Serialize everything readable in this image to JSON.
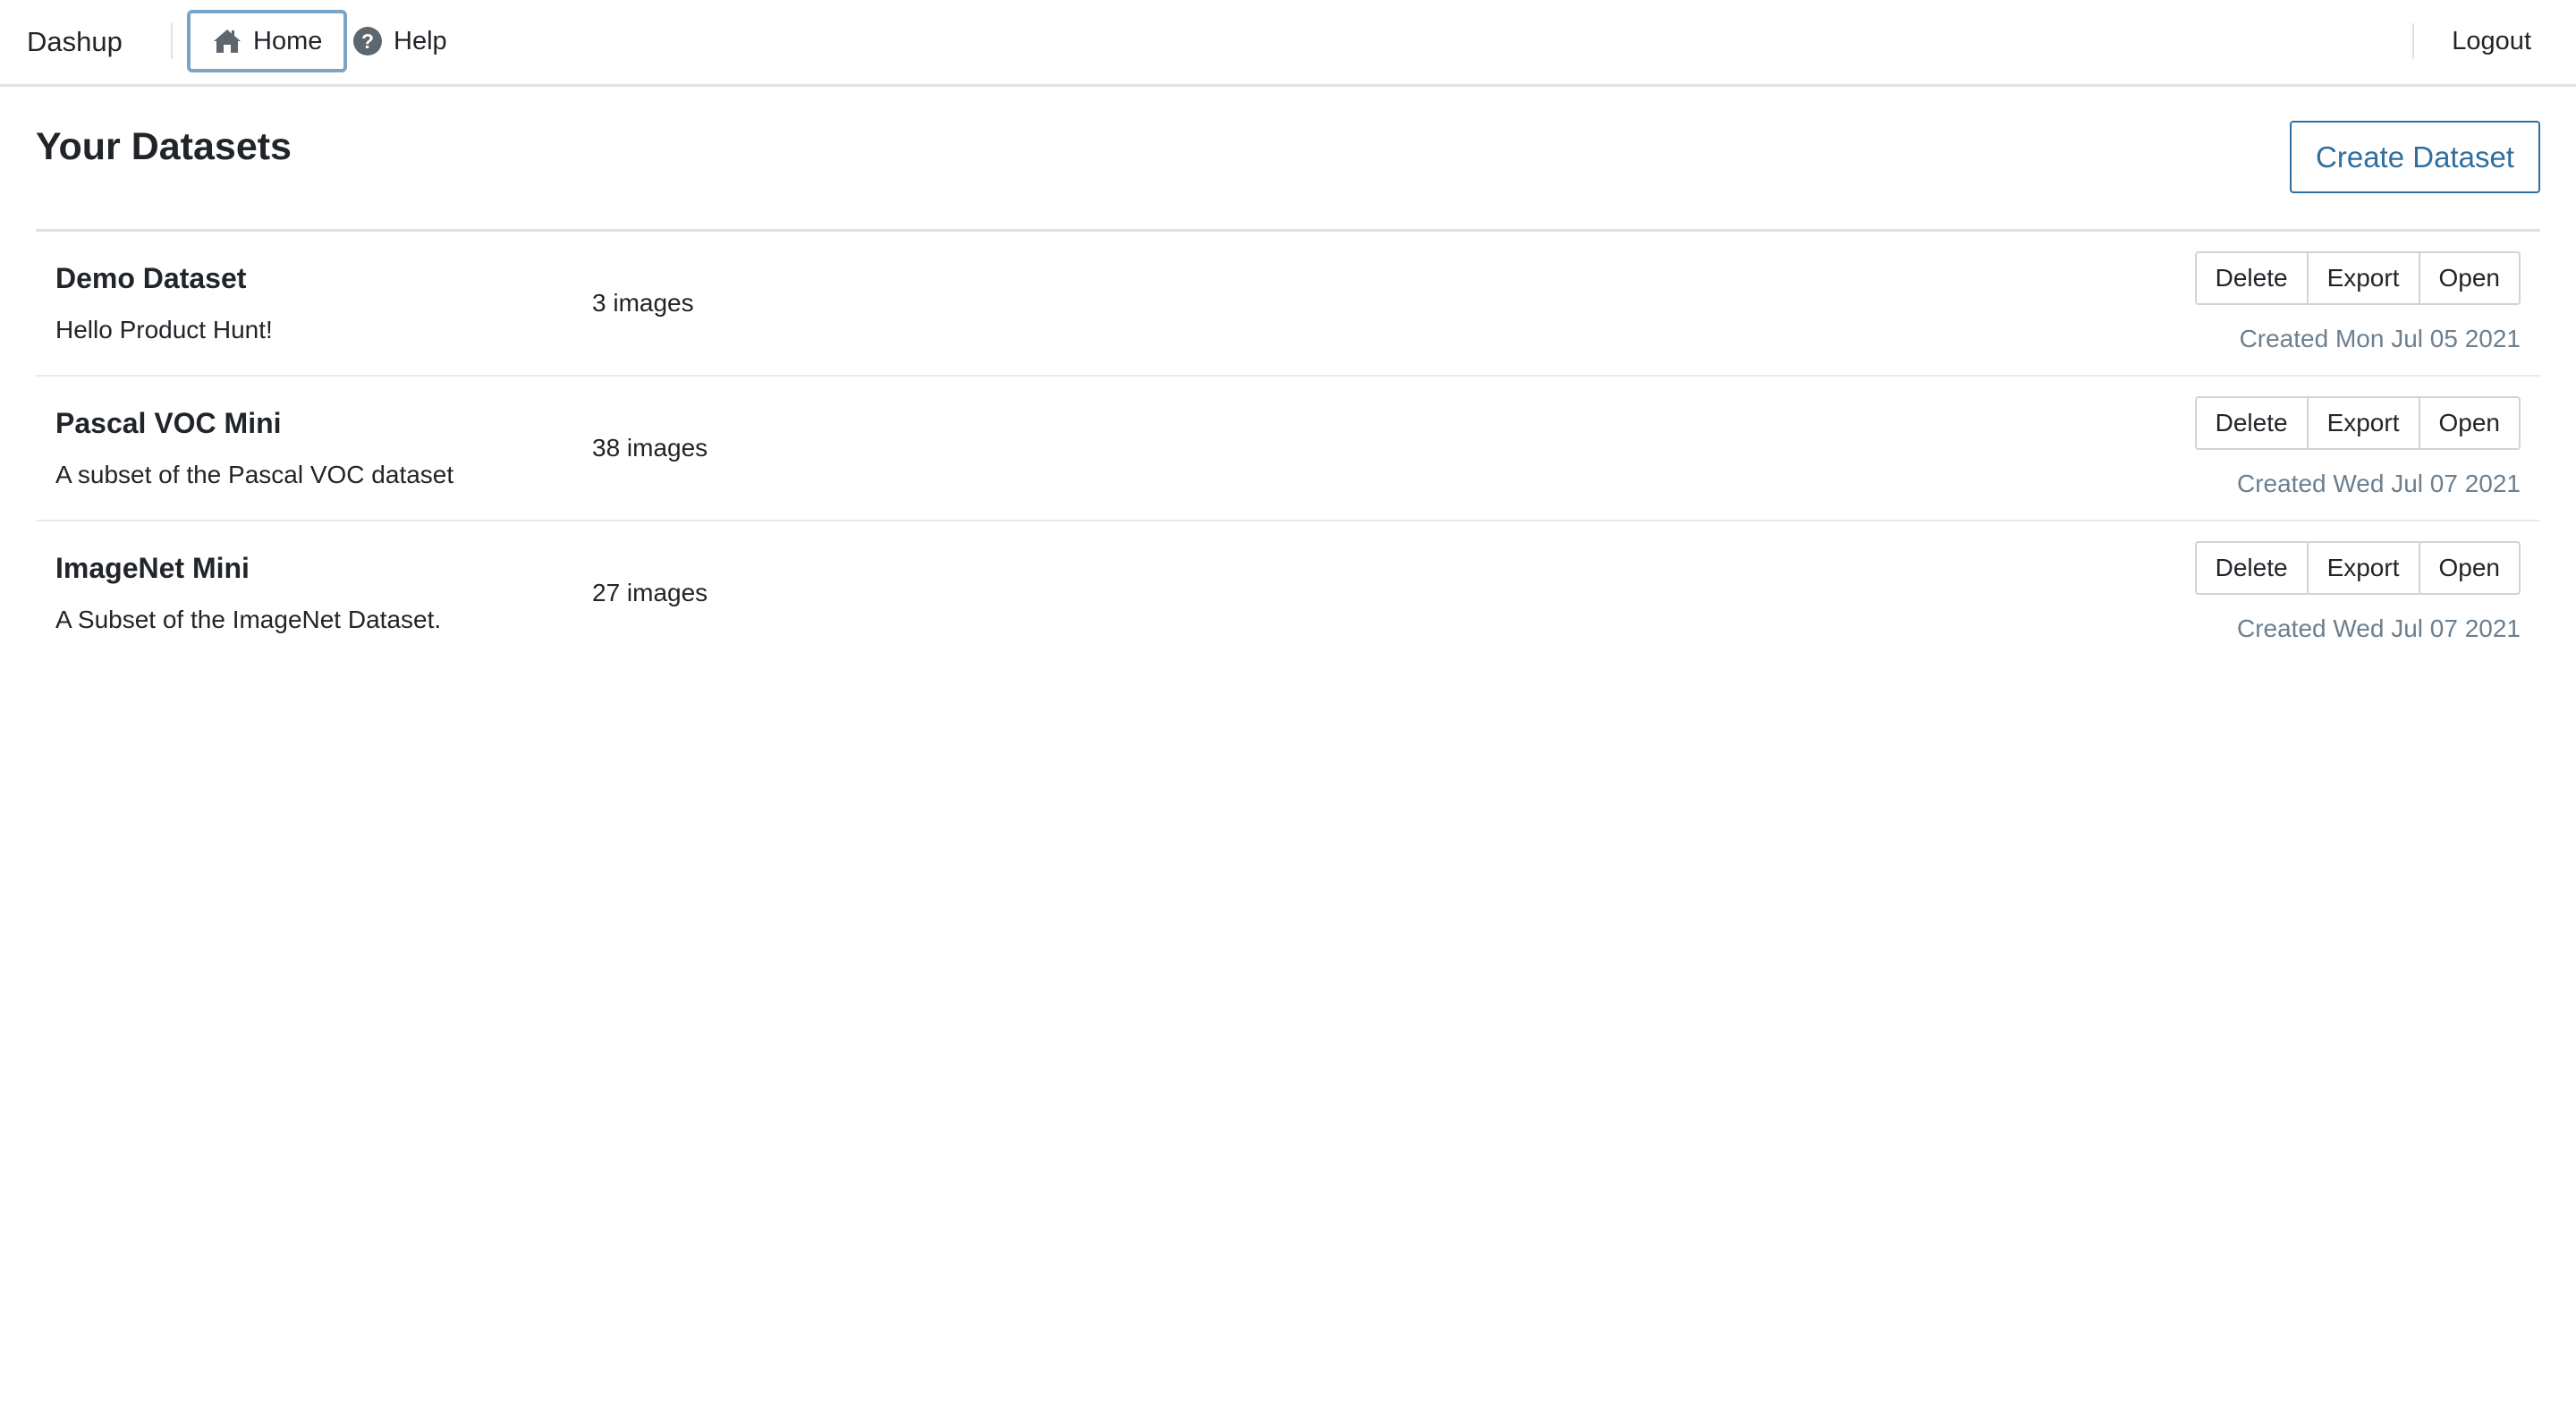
{
  "nav": {
    "brand": "Dashup",
    "items": [
      {
        "label": "Home",
        "icon": "home-icon",
        "active": true
      },
      {
        "label": "Help",
        "icon": "help-icon",
        "active": false
      }
    ],
    "logout": "Logout"
  },
  "page": {
    "title": "Your Datasets",
    "create_button": "Create Dataset"
  },
  "datasets": [
    {
      "name": "Demo Dataset",
      "description": "Hello Product Hunt!",
      "count": "3 images",
      "created": "Created Mon Jul 05 2021"
    },
    {
      "name": "Pascal VOC Mini",
      "description": "A subset of the Pascal VOC dataset",
      "count": "38 images",
      "created": "Created Wed Jul 07 2021"
    },
    {
      "name": "ImageNet Mini",
      "description": "A Subset of the ImageNet Dataset.",
      "count": "27 images",
      "created": "Created Wed Jul 07 2021"
    }
  ],
  "row_actions": {
    "delete": "Delete",
    "export": "Export",
    "open": "Open"
  },
  "colors": {
    "accent": "#2f6f9f",
    "active_outline": "#7aa5c6",
    "muted_text": "#6c7f8f",
    "border": "#dee2e6"
  }
}
